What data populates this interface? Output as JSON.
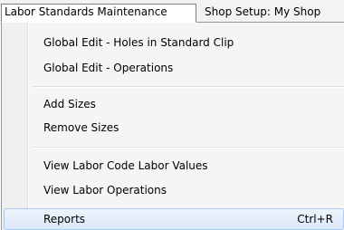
{
  "menubar": {
    "menus": [
      {
        "label": "Labor Standards Maintenance"
      },
      {
        "label": "Shop Setup: My Shop"
      }
    ]
  },
  "dropdown": {
    "groups": [
      {
        "items": [
          {
            "label": "Global Edit - Holes in Standard Clip"
          },
          {
            "label": "Global Edit - Operations"
          }
        ]
      },
      {
        "items": [
          {
            "label": "Add Sizes"
          },
          {
            "label": "Remove Sizes"
          }
        ]
      },
      {
        "items": [
          {
            "label": "View Labor Code Labor Values"
          },
          {
            "label": "View Labor Operations"
          }
        ]
      },
      {
        "items": [
          {
            "label": "Reports",
            "shortcut": "Ctrl+R",
            "highlighted": true
          }
        ]
      }
    ]
  }
}
